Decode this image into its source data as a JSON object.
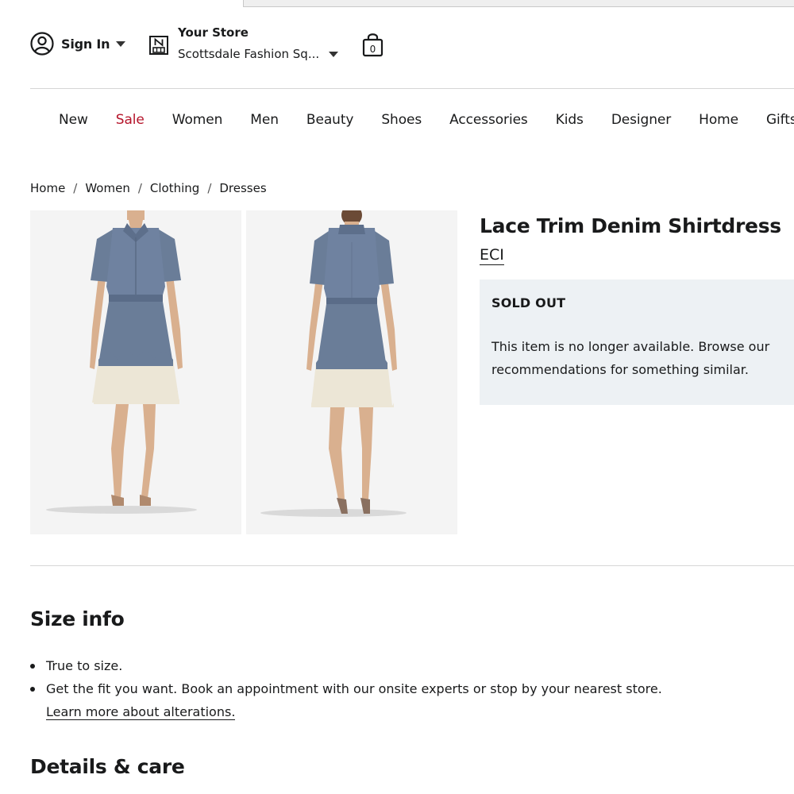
{
  "header": {
    "sign_in_label": "Sign In",
    "store_title": "Your Store",
    "store_name": "Scottsdale Fashion Sq...",
    "bag_count": "0"
  },
  "nav": [
    "New",
    "Sale",
    "Women",
    "Men",
    "Beauty",
    "Shoes",
    "Accessories",
    "Kids",
    "Designer",
    "Home",
    "Gifts"
  ],
  "breadcrumb": [
    "Home",
    "Women",
    "Clothing",
    "Dresses"
  ],
  "breadcrumb_separator": "/",
  "product": {
    "title": "Lace Trim Denim Shirtdress",
    "brand": "ECI",
    "status_heading": "SOLD OUT",
    "status_message": "This item is no longer available. Browse our recommendations for something similar."
  },
  "size_info": {
    "heading": "Size info",
    "bullet_1": "True to size.",
    "bullet_2": "Get the fit you want. Book an appointment with our onsite experts or stop by your nearest store.",
    "alterations_link": "Learn more about alterations."
  },
  "details": {
    "heading": "Details & care"
  },
  "colors": {
    "sale": "#b5152b",
    "sold_out_bg": "#edf1f4",
    "denim": "#6a7d98",
    "lace": "#ece6d6"
  }
}
